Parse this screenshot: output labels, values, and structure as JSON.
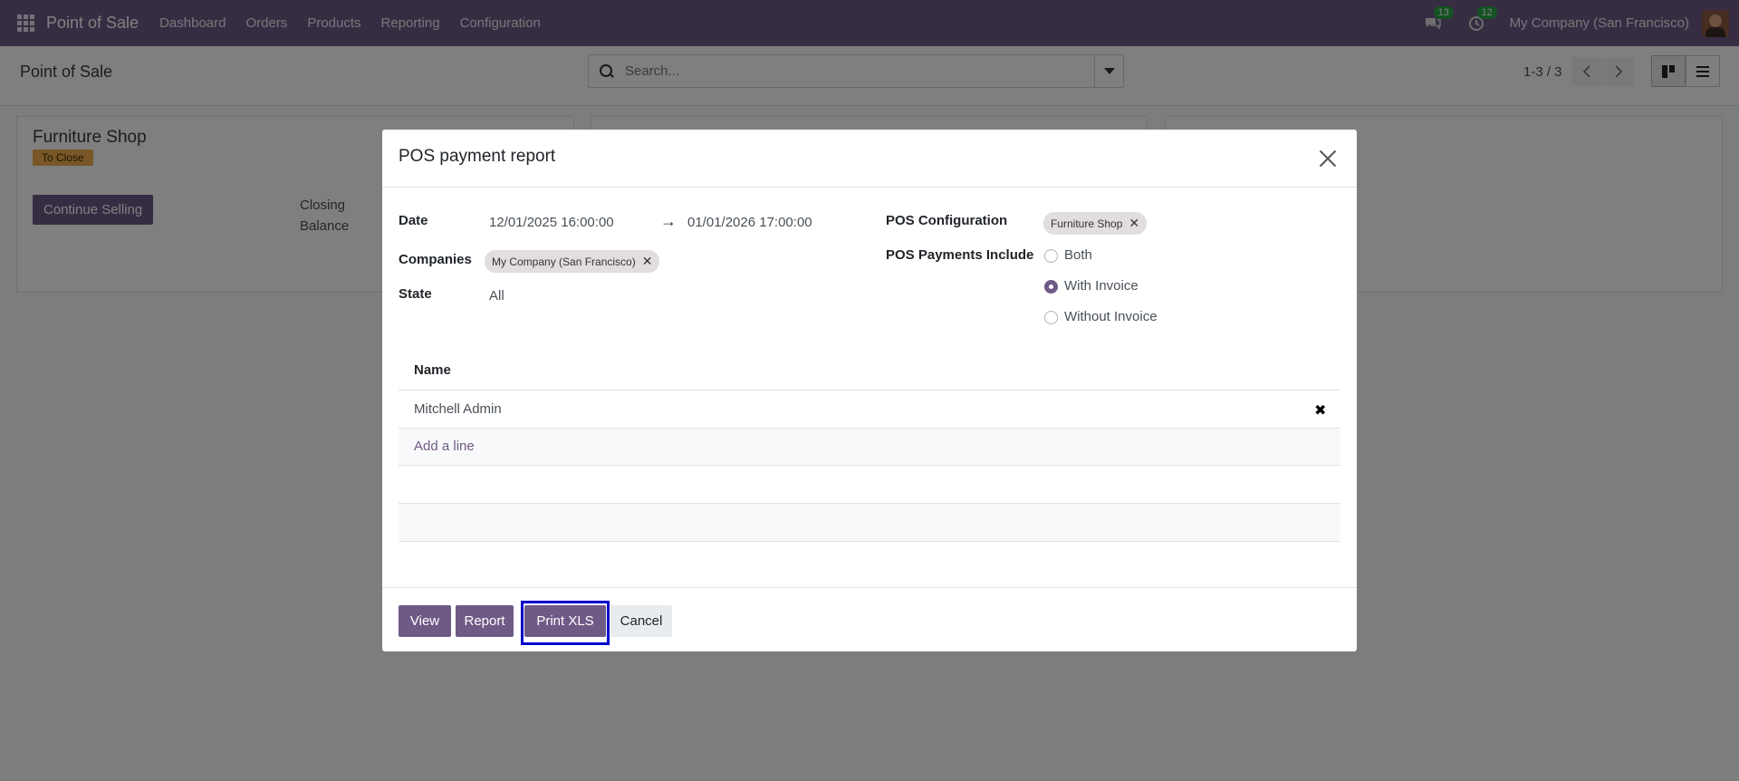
{
  "navbar": {
    "brand": "Point of Sale",
    "menu": [
      "Dashboard",
      "Orders",
      "Products",
      "Reporting",
      "Configuration"
    ],
    "messages_count": "13",
    "activities_count": "12",
    "company": "My Company (San Francisco)"
  },
  "control_panel": {
    "title": "Point of Sale",
    "search_placeholder": "Search...",
    "pager": "1-3 / 3"
  },
  "kanban": {
    "card_title": "Furniture Shop",
    "card_badge": "To Close",
    "card_button": "Continue Selling",
    "card_closing": "Closing Balance"
  },
  "modal": {
    "title": "POS payment report",
    "date_label": "Date",
    "date_from": "12/01/2025 16:00:00",
    "date_to": "01/01/2026 17:00:00",
    "companies_label": "Companies",
    "company_tag": "My Company (San Francisco)",
    "state_label": "State",
    "state_value": "All",
    "pos_config_label": "POS Configuration",
    "pos_config_tag": "Furniture Shop",
    "payments_include_label": "POS Payments Include",
    "payments_options": [
      "Both",
      "With Invoice",
      "Without Invoice"
    ],
    "payments_selected": "With Invoice",
    "table": {
      "header": "Name",
      "rows": [
        "Mitchell Admin"
      ],
      "add_line": "Add a line"
    },
    "buttons": {
      "view": "View",
      "report": "Report",
      "print_xls": "Print XLS",
      "cancel": "Cancel"
    }
  },
  "colors": {
    "brand": "#6f5a86",
    "badge": "#f0ad4e",
    "highlight": "#0000cc"
  }
}
